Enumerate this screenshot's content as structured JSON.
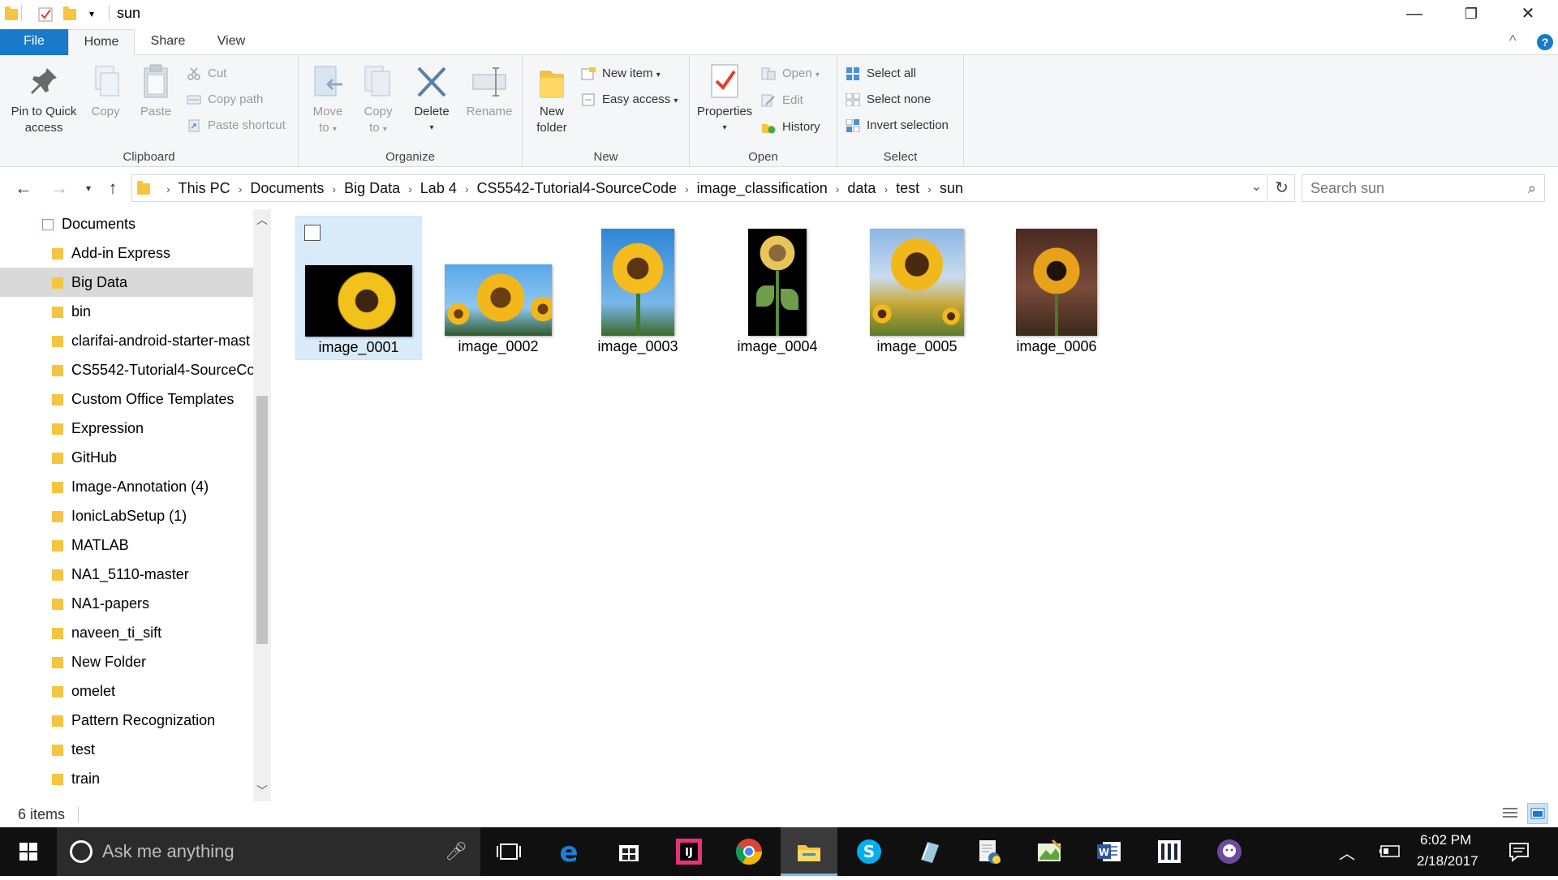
{
  "window": {
    "title": "sun",
    "controls": {
      "minimize": "—",
      "restore": "❐",
      "close": "✕"
    }
  },
  "ribbon": {
    "tabs": [
      "File",
      "Home",
      "Share",
      "View"
    ],
    "help": "?",
    "collapse": "^",
    "clipboard": {
      "label": "Clipboard",
      "pin": "Pin to Quick access",
      "pin_line1": "Pin to Quick",
      "pin_line2": "access",
      "copy": "Copy",
      "paste": "Paste",
      "cut": "Cut",
      "copy_path": "Copy path",
      "paste_shortcut": "Paste shortcut"
    },
    "organize": {
      "label": "Organize",
      "move_to_1": "Move",
      "move_to_2": "to",
      "copy_to_1": "Copy",
      "copy_to_2": "to",
      "delete": "Delete",
      "rename": "Rename"
    },
    "new": {
      "label": "New",
      "new_folder_1": "New",
      "new_folder_2": "folder",
      "new_item": "New item",
      "easy_access": "Easy access"
    },
    "open": {
      "label": "Open",
      "properties": "Properties",
      "open": "Open",
      "edit": "Edit",
      "history": "History"
    },
    "select": {
      "label": "Select",
      "select_all": "Select all",
      "select_none": "Select none",
      "invert": "Invert selection"
    }
  },
  "address": {
    "crumbs": [
      "This PC",
      "Documents",
      "Big Data",
      "Lab 4",
      "CS5542-Tutorial4-SourceCode",
      "image_classification",
      "data",
      "test",
      "sun"
    ],
    "search_placeholder": "Search sun"
  },
  "navpane": {
    "root": "Documents",
    "items": [
      "Add-in Express",
      "Big Data",
      "bin",
      "clarifai-android-starter-mast",
      "CS5542-Tutorial4-SourceCo",
      "Custom Office Templates",
      "Expression",
      "GitHub",
      "Image-Annotation (4)",
      "IonicLabSetup (1)",
      "MATLAB",
      "NA1_5110-master",
      "NA1-papers",
      "naveen_ti_sift",
      "New Folder",
      "omelet",
      "Pattern Recognization",
      "test",
      "train"
    ],
    "selected": "Big Data"
  },
  "files": [
    {
      "name": "image_0001",
      "selected": true
    },
    {
      "name": "image_0002",
      "selected": false
    },
    {
      "name": "image_0003",
      "selected": false
    },
    {
      "name": "image_0004",
      "selected": false
    },
    {
      "name": "image_0005",
      "selected": false
    },
    {
      "name": "image_0006",
      "selected": false
    }
  ],
  "status": {
    "count": "6 items"
  },
  "taskbar": {
    "search_placeholder": "Ask me anything",
    "time": "6:02 PM",
    "date": "2/18/2017",
    "apps": [
      "task-view",
      "edge",
      "store",
      "intellij",
      "chrome",
      "file-explorer",
      "skype",
      "notepad",
      "python-editor",
      "paint",
      "word",
      "app-square",
      "github"
    ]
  },
  "colors": {
    "accent": "#1979ca",
    "selection": "#d9ebf9",
    "taskbar": "#101010",
    "folder": "#f5c542"
  }
}
